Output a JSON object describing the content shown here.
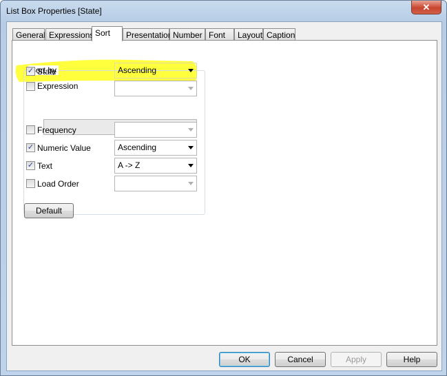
{
  "window": {
    "title": "List Box Properties [State]",
    "close_icon": "close-icon"
  },
  "tabs": [
    {
      "label": "General"
    },
    {
      "label": "Expressions"
    },
    {
      "label": "Sort",
      "selected": true
    },
    {
      "label": "Presentation"
    },
    {
      "label": "Number"
    },
    {
      "label": "Font"
    },
    {
      "label": "Layout"
    },
    {
      "label": "Caption"
    }
  ],
  "sort": {
    "group_label": "Sort by",
    "rows": [
      {
        "label": "State",
        "checked": true,
        "value": "Ascending",
        "enabled": true
      },
      {
        "label": "Expression",
        "checked": false,
        "value": "",
        "enabled": false
      },
      {
        "label": "Frequency",
        "checked": false,
        "value": "",
        "enabled": false
      },
      {
        "label": "Numeric Value",
        "checked": true,
        "value": "Ascending",
        "enabled": true
      },
      {
        "label": "Text",
        "checked": true,
        "value": "A -> Z",
        "enabled": true
      },
      {
        "label": "Load Order",
        "checked": false,
        "value": "",
        "enabled": false
      }
    ],
    "expression_value": "",
    "default_label": "Default",
    "highlight_color": "#ffff33"
  },
  "buttons": {
    "ok": "OK",
    "cancel": "Cancel",
    "apply": "Apply",
    "help": "Help"
  }
}
